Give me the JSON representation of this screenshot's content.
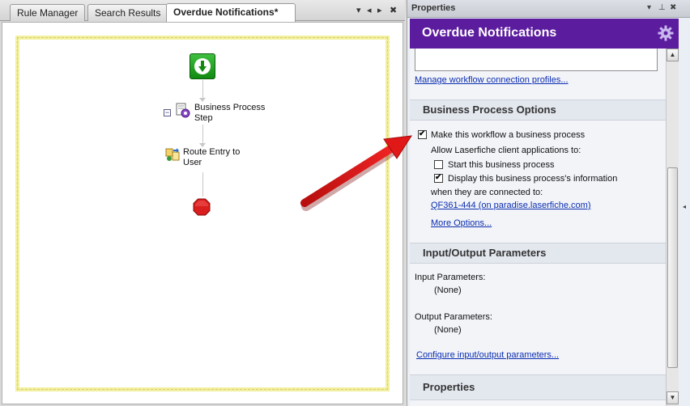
{
  "tabs": [
    {
      "label": "Rule Manager"
    },
    {
      "label": "Search Results"
    },
    {
      "label": "Overdue Notifications*"
    }
  ],
  "tab_controls": {
    "dropdown": "▾",
    "prev": "◂",
    "next": "▸",
    "close": "✖"
  },
  "workflow": {
    "steps": [
      {
        "label": "Business Process Step",
        "icon": "business-process-icon"
      },
      {
        "label": "Route Entry to User",
        "icon": "route-entry-icon"
      }
    ],
    "start_icon": "start-arrow-icon",
    "end_icon": "stop-icon",
    "collapse_glyph": "−"
  },
  "properties": {
    "pane_title": "Properties",
    "pane_controls": {
      "dropdown": "▾",
      "pin": "⊥",
      "close": "✖"
    },
    "header_title": "Overdue Notifications",
    "manage_link": "Manage workflow connection profiles...",
    "sections": {
      "bpo": {
        "title": "Business Process Options",
        "make_label": "Make this workflow a business process",
        "make_checked": true,
        "allow_label": "Allow Laserfiche client applications to:",
        "start_label": "Start this business process",
        "start_checked": false,
        "display_label": "Display this business process's information",
        "display_checked": true,
        "when_label": "when they are connected to:",
        "server_link": "QF361-444 (on paradise.laserfiche.com)",
        "more_link": "More Options..."
      },
      "io": {
        "title": "Input/Output Parameters",
        "input_label": "Input Parameters:",
        "input_value": "(None)",
        "output_label": "Output Parameters:",
        "output_value": "(None)",
        "config_link": "Configure input/output parameters..."
      },
      "props": {
        "title": "Properties"
      }
    },
    "scrollbar": {
      "up": "▲",
      "down": "▼"
    },
    "grip": "◂",
    "colors": {
      "header": "#5c1c9e",
      "link": "#0c2db0",
      "arrow": "#e01818"
    }
  }
}
